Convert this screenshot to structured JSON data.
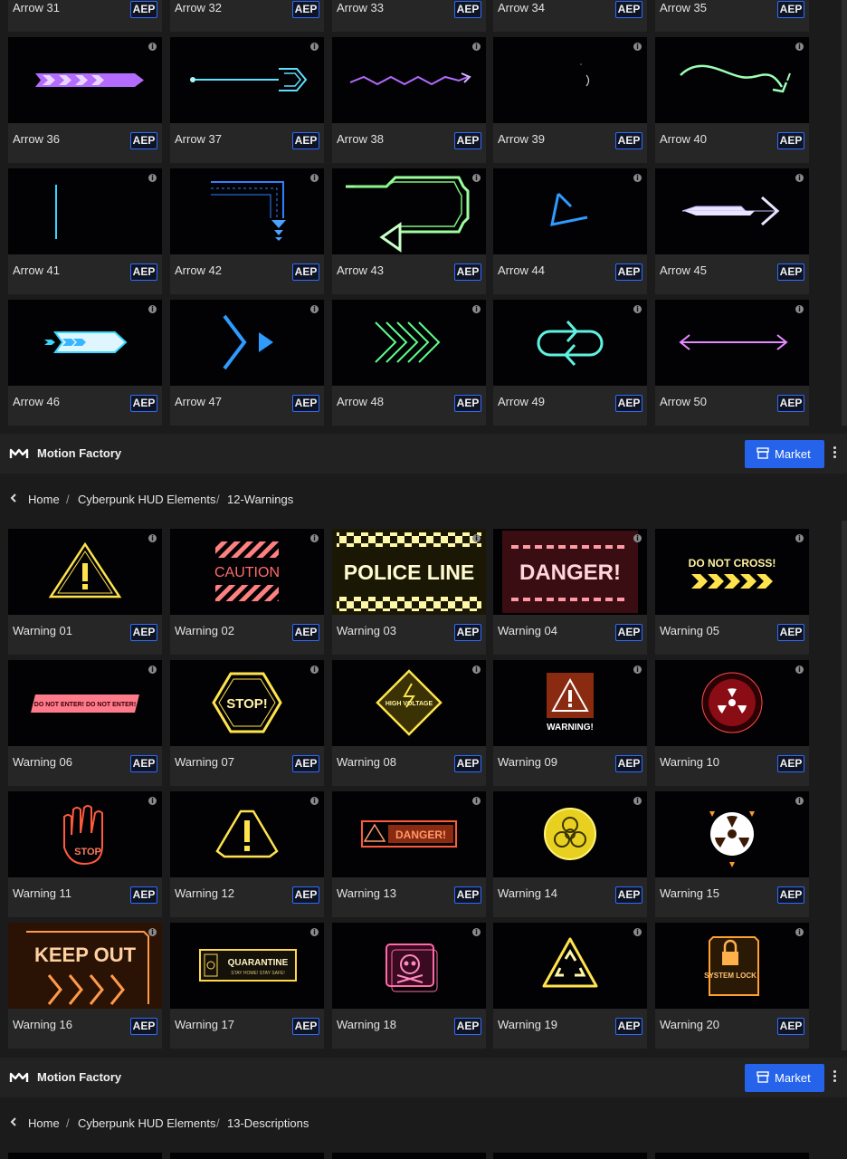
{
  "brand": {
    "name": "Motion Factory",
    "market_label": "Market"
  },
  "breadcrumbs_warnings": {
    "home": "Home",
    "collection": "Cyberpunk HUD Elements",
    "current": "12-Warnings"
  },
  "breadcrumbs_descriptions": {
    "home": "Home",
    "collection": "Cyberpunk HUD Elements",
    "current": "13-Descriptions"
  },
  "badge": "AEP",
  "arrows": [
    {
      "name": "Arrow 31"
    },
    {
      "name": "Arrow 32"
    },
    {
      "name": "Arrow 33"
    },
    {
      "name": "Arrow 34"
    },
    {
      "name": "Arrow 35"
    },
    {
      "name": "Arrow 36"
    },
    {
      "name": "Arrow 37"
    },
    {
      "name": "Arrow 38"
    },
    {
      "name": "Arrow 39"
    },
    {
      "name": "Arrow 40"
    },
    {
      "name": "Arrow 41"
    },
    {
      "name": "Arrow 42"
    },
    {
      "name": "Arrow 43"
    },
    {
      "name": "Arrow 44"
    },
    {
      "name": "Arrow 45"
    },
    {
      "name": "Arrow 46"
    },
    {
      "name": "Arrow 47"
    },
    {
      "name": "Arrow 48"
    },
    {
      "name": "Arrow 49"
    },
    {
      "name": "Arrow 50"
    }
  ],
  "warnings": [
    {
      "name": "Warning 01",
      "text": ""
    },
    {
      "name": "Warning 02",
      "text": "CAUTION"
    },
    {
      "name": "Warning 03",
      "text": "POLICE LINE"
    },
    {
      "name": "Warning 04",
      "text": "DANGER!"
    },
    {
      "name": "Warning 05",
      "text": "DO NOT CROSS!"
    },
    {
      "name": "Warning 06",
      "text": "DO NOT ENTER!  DO NOT ENTER!"
    },
    {
      "name": "Warning 07",
      "text": "STOP!"
    },
    {
      "name": "Warning 08",
      "text": "HIGH VOLTAGE"
    },
    {
      "name": "Warning 09",
      "text": "WARNING!"
    },
    {
      "name": "Warning 10",
      "text": ""
    },
    {
      "name": "Warning 11",
      "text": "STOP"
    },
    {
      "name": "Warning 12",
      "text": ""
    },
    {
      "name": "Warning 13",
      "text": "DANGER!"
    },
    {
      "name": "Warning 14",
      "text": ""
    },
    {
      "name": "Warning 15",
      "text": ""
    },
    {
      "name": "Warning 16",
      "text": "KEEP OUT"
    },
    {
      "name": "Warning 17",
      "text": "QUARANTINE",
      "sub": "STAY HOME! STAY SAFE!"
    },
    {
      "name": "Warning 18",
      "text": ""
    },
    {
      "name": "Warning 19",
      "text": ""
    },
    {
      "name": "Warning 20",
      "text": "SYSTEM LOCK"
    }
  ],
  "colors": {
    "accent": "#2563eb",
    "badge_border": "#2f6bff",
    "yellow": "#ffe34d",
    "red": "#ff4b4b",
    "cyan": "#38d6ff",
    "purple": "#a855f7"
  }
}
